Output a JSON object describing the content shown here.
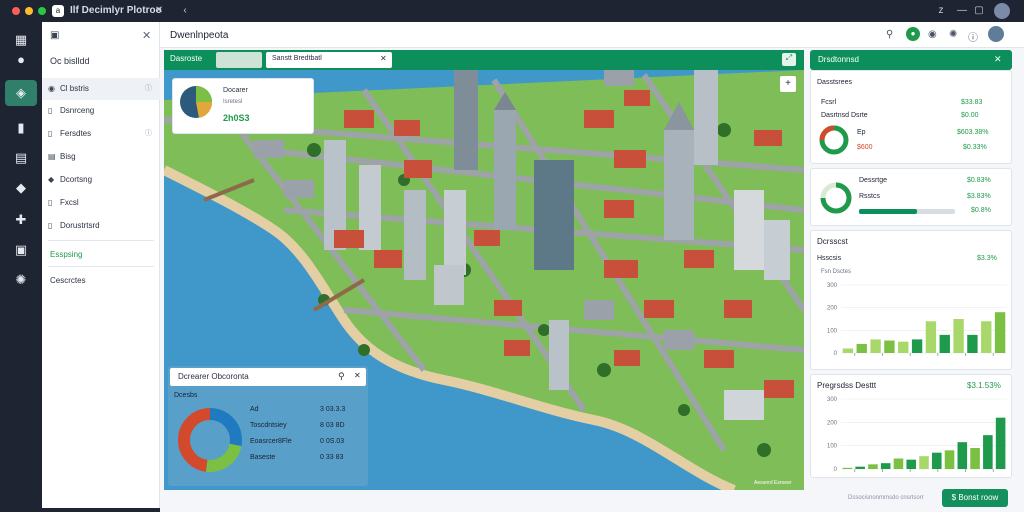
{
  "window": {
    "title": "Ilf Decimlyr Plotroo"
  },
  "colors": {
    "accent": "#0d8f5c",
    "positive": "#1f9a4c",
    "negative": "#d24a2b",
    "water": "#3f98c9",
    "land": "#7ebd57"
  },
  "sidebar": {
    "title": "Oc bislldd",
    "items": [
      {
        "label": "Cl bstris",
        "icon": "eye-icon",
        "active": true
      },
      {
        "label": "Dsnrceng",
        "icon": "bookmark-icon"
      },
      {
        "label": "Fersdtes",
        "icon": "flag-icon"
      },
      {
        "label": "Bisg",
        "icon": "grid-icon"
      },
      {
        "label": "Dcortsng",
        "icon": "drop-icon"
      },
      {
        "label": "Fxcsl",
        "icon": "puzzle-icon"
      },
      {
        "label": "Dorustrtsrd",
        "icon": "list-icon"
      }
    ],
    "section_label": "Esspsing",
    "footer_label": "Cescrctes"
  },
  "header": {
    "title": "Dwenlnpeota"
  },
  "map": {
    "tab_label": "Dasroste",
    "dropdown_value": "Sanstt Bredtbatl",
    "info_card": {
      "title": "Docarer",
      "subtitle": "Isretesl",
      "value": "2h0S3"
    },
    "search": {
      "placeholder": "Dcrearer Obcoronta"
    },
    "stats": {
      "title": "Dcesbs",
      "rows": [
        {
          "label": "Ad",
          "value": "3 03.3.3"
        },
        {
          "label": "Toscdntsiey",
          "value": "8 03 8D"
        },
        {
          "label": "Eoasrcer8Fle",
          "value": "0 0S.03"
        },
        {
          "label": "Baseste",
          "value": "0 33 83"
        }
      ],
      "donut": [
        {
          "color": "#1f7ac0",
          "fraction": 0.28
        },
        {
          "color": "#7bc043",
          "fraction": 0.24
        },
        {
          "color": "#d24a2b",
          "fraction": 0.48
        }
      ]
    },
    "watermark": "Aesunrd Esroeer"
  },
  "right": {
    "header_title": "Drsdtonnsd",
    "card1": {
      "title": "Dasstsrees",
      "rows": [
        {
          "label": "Fcsrl",
          "value": "$33.83"
        },
        {
          "label": "Dasrtnsd Dsrte",
          "value": "$0.00"
        },
        {
          "label": "Ep",
          "value": "$603.38%"
        },
        {
          "label": "$600",
          "value": "$0.33%"
        }
      ]
    },
    "card2": {
      "title": "Dessrtge",
      "rows": [
        {
          "label": "Rsstcs",
          "value": "$0.83%"
        },
        {
          "label": "",
          "value": "$3.83%"
        },
        {
          "label": "",
          "value": "$0.8%"
        }
      ],
      "progress": 0.6
    },
    "chart1": {
      "title": "Dcrsscst",
      "subtitle": "Hsscsis",
      "badge": "$3.3%",
      "legend": "Fsn Dsctes"
    },
    "chart2": {
      "title": "Pregrsdss Desttt",
      "badge": "$3.1.53%"
    },
    "footer": {
      "link": "Dssocisnonmmsdo cnsrtsorr",
      "button": "$ Bonst roow"
    }
  },
  "chart_data": [
    {
      "type": "bar",
      "title": "Dcrsscst",
      "ylim": [
        0,
        300
      ],
      "yticks": [
        "0",
        "100",
        "200",
        "300"
      ],
      "xlabel": "",
      "ylabel": "",
      "series": [
        {
          "values": [
            20,
            40,
            60,
            55,
            50,
            60,
            140,
            80,
            150,
            80,
            140,
            180
          ]
        }
      ],
      "colors": [
        "#a9d86a",
        "#7bc043",
        "#a9d86a",
        "#7bc043",
        "#a9d86a",
        "#1f9a4c",
        "#a9d86a",
        "#1f9a4c",
        "#a9d86a",
        "#1f9a4c",
        "#a9d86a",
        "#7bc043"
      ]
    },
    {
      "type": "bar",
      "title": "Pregrsdss Desttt",
      "ylim": [
        0,
        300
      ],
      "yticks": [
        "0",
        "100",
        "200",
        "300"
      ],
      "xlabel": "",
      "ylabel": "",
      "series": [
        {
          "values": [
            5,
            10,
            20,
            25,
            45,
            40,
            55,
            70,
            80,
            115,
            90,
            145,
            220
          ]
        }
      ],
      "colors": [
        "#7bc043",
        "#1f9a4c",
        "#7bc043",
        "#1f9a4c",
        "#7bc043",
        "#1f9a4c",
        "#a9d86a",
        "#1f9a4c",
        "#7bc043",
        "#1f9a4c",
        "#7bc043",
        "#1f9a4c",
        "#1f9a4c"
      ]
    }
  ]
}
